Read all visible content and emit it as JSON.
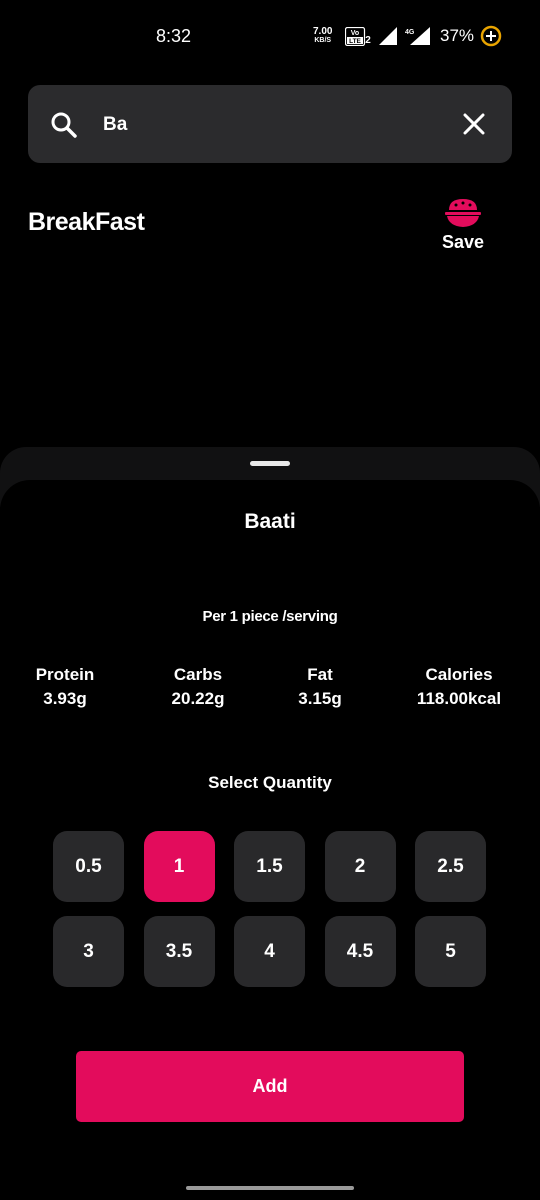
{
  "status_bar": {
    "time": "8:32",
    "net_speed_value": "7.00",
    "net_speed_unit": "KB/S",
    "volte_label": "Vo LTE 2",
    "network_label": "4G",
    "battery": "37%"
  },
  "search": {
    "query": "Ba",
    "icon": "search-icon",
    "clear_icon": "close-icon"
  },
  "meal": {
    "title": "BreakFast",
    "save_label": "Save",
    "save_icon": "bowl-icon"
  },
  "sheet": {
    "food_name": "Baati",
    "serving_text": "Per 1 piece  /serving",
    "nutrients": [
      {
        "label": "Protein",
        "value": "3.93g"
      },
      {
        "label": "Carbs",
        "value": "20.22g"
      },
      {
        "label": "Fat",
        "value": "3.15g"
      },
      {
        "label": "Calories",
        "value": "118.00kcal"
      }
    ],
    "select_quantity_label": "Select Quantity",
    "quantities": [
      "0.5",
      "1",
      "1.5",
      "2",
      "2.5",
      "3",
      "3.5",
      "4",
      "4.5",
      "5"
    ],
    "selected_quantity": "1",
    "add_label": "Add"
  },
  "colors": {
    "accent": "#e30c5c",
    "background": "#000000",
    "surface": "#2b2b2d"
  }
}
